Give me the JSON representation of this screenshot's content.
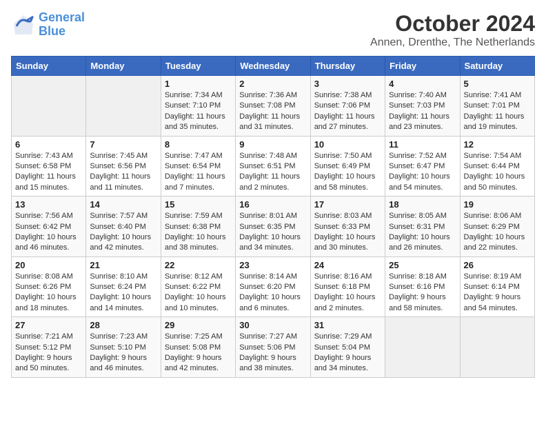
{
  "header": {
    "logo_line1": "General",
    "logo_line2": "Blue",
    "month": "October 2024",
    "location": "Annen, Drenthe, The Netherlands"
  },
  "weekdays": [
    "Sunday",
    "Monday",
    "Tuesday",
    "Wednesday",
    "Thursday",
    "Friday",
    "Saturday"
  ],
  "weeks": [
    [
      {
        "day": "",
        "empty": true
      },
      {
        "day": "",
        "empty": true
      },
      {
        "day": "1",
        "sunrise": "7:34 AM",
        "sunset": "7:10 PM",
        "daylight": "11 hours and 35 minutes."
      },
      {
        "day": "2",
        "sunrise": "7:36 AM",
        "sunset": "7:08 PM",
        "daylight": "11 hours and 31 minutes."
      },
      {
        "day": "3",
        "sunrise": "7:38 AM",
        "sunset": "7:06 PM",
        "daylight": "11 hours and 27 minutes."
      },
      {
        "day": "4",
        "sunrise": "7:40 AM",
        "sunset": "7:03 PM",
        "daylight": "11 hours and 23 minutes."
      },
      {
        "day": "5",
        "sunrise": "7:41 AM",
        "sunset": "7:01 PM",
        "daylight": "11 hours and 19 minutes."
      }
    ],
    [
      {
        "day": "6",
        "sunrise": "7:43 AM",
        "sunset": "6:58 PM",
        "daylight": "11 hours and 15 minutes."
      },
      {
        "day": "7",
        "sunrise": "7:45 AM",
        "sunset": "6:56 PM",
        "daylight": "11 hours and 11 minutes."
      },
      {
        "day": "8",
        "sunrise": "7:47 AM",
        "sunset": "6:54 PM",
        "daylight": "11 hours and 7 minutes."
      },
      {
        "day": "9",
        "sunrise": "7:48 AM",
        "sunset": "6:51 PM",
        "daylight": "11 hours and 2 minutes."
      },
      {
        "day": "10",
        "sunrise": "7:50 AM",
        "sunset": "6:49 PM",
        "daylight": "10 hours and 58 minutes."
      },
      {
        "day": "11",
        "sunrise": "7:52 AM",
        "sunset": "6:47 PM",
        "daylight": "10 hours and 54 minutes."
      },
      {
        "day": "12",
        "sunrise": "7:54 AM",
        "sunset": "6:44 PM",
        "daylight": "10 hours and 50 minutes."
      }
    ],
    [
      {
        "day": "13",
        "sunrise": "7:56 AM",
        "sunset": "6:42 PM",
        "daylight": "10 hours and 46 minutes."
      },
      {
        "day": "14",
        "sunrise": "7:57 AM",
        "sunset": "6:40 PM",
        "daylight": "10 hours and 42 minutes."
      },
      {
        "day": "15",
        "sunrise": "7:59 AM",
        "sunset": "6:38 PM",
        "daylight": "10 hours and 38 minutes."
      },
      {
        "day": "16",
        "sunrise": "8:01 AM",
        "sunset": "6:35 PM",
        "daylight": "10 hours and 34 minutes."
      },
      {
        "day": "17",
        "sunrise": "8:03 AM",
        "sunset": "6:33 PM",
        "daylight": "10 hours and 30 minutes."
      },
      {
        "day": "18",
        "sunrise": "8:05 AM",
        "sunset": "6:31 PM",
        "daylight": "10 hours and 26 minutes."
      },
      {
        "day": "19",
        "sunrise": "8:06 AM",
        "sunset": "6:29 PM",
        "daylight": "10 hours and 22 minutes."
      }
    ],
    [
      {
        "day": "20",
        "sunrise": "8:08 AM",
        "sunset": "6:26 PM",
        "daylight": "10 hours and 18 minutes."
      },
      {
        "day": "21",
        "sunrise": "8:10 AM",
        "sunset": "6:24 PM",
        "daylight": "10 hours and 14 minutes."
      },
      {
        "day": "22",
        "sunrise": "8:12 AM",
        "sunset": "6:22 PM",
        "daylight": "10 hours and 10 minutes."
      },
      {
        "day": "23",
        "sunrise": "8:14 AM",
        "sunset": "6:20 PM",
        "daylight": "10 hours and 6 minutes."
      },
      {
        "day": "24",
        "sunrise": "8:16 AM",
        "sunset": "6:18 PM",
        "daylight": "10 hours and 2 minutes."
      },
      {
        "day": "25",
        "sunrise": "8:18 AM",
        "sunset": "6:16 PM",
        "daylight": "9 hours and 58 minutes."
      },
      {
        "day": "26",
        "sunrise": "8:19 AM",
        "sunset": "6:14 PM",
        "daylight": "9 hours and 54 minutes."
      }
    ],
    [
      {
        "day": "27",
        "sunrise": "7:21 AM",
        "sunset": "5:12 PM",
        "daylight": "9 hours and 50 minutes."
      },
      {
        "day": "28",
        "sunrise": "7:23 AM",
        "sunset": "5:10 PM",
        "daylight": "9 hours and 46 minutes."
      },
      {
        "day": "29",
        "sunrise": "7:25 AM",
        "sunset": "5:08 PM",
        "daylight": "9 hours and 42 minutes."
      },
      {
        "day": "30",
        "sunrise": "7:27 AM",
        "sunset": "5:06 PM",
        "daylight": "9 hours and 38 minutes."
      },
      {
        "day": "31",
        "sunrise": "7:29 AM",
        "sunset": "5:04 PM",
        "daylight": "9 hours and 34 minutes."
      },
      {
        "day": "",
        "empty": true
      },
      {
        "day": "",
        "empty": true
      }
    ]
  ]
}
